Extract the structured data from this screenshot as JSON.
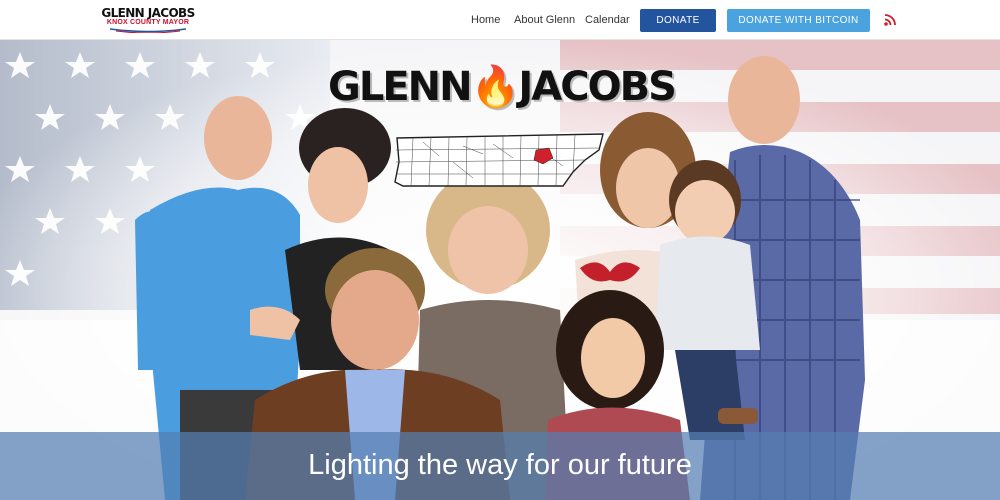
{
  "header": {
    "logo": {
      "name": "GLENN JACOBS",
      "subtitle": "KNOX COUNTY MAYOR"
    },
    "nav": [
      {
        "label": "Home"
      },
      {
        "label": "About Glenn"
      },
      {
        "label": "Calendar"
      }
    ],
    "buttons": {
      "donate": "DONATE",
      "donate_bitcoin": "DONATE WITH BITCOIN"
    },
    "rss_icon": "rss-icon"
  },
  "hero": {
    "wordmark": {
      "first": "GLENN",
      "last": "JACOBS",
      "flame_icon": "flame-icon"
    },
    "map_icon": "tennessee-counties-map",
    "tagline": "Lighting the way for our future"
  },
  "colors": {
    "brand_red": "#c8102e",
    "donate_blue": "#23549e",
    "bitcoin_blue": "#4aa3df",
    "tagline_bar": "#547eb2"
  }
}
